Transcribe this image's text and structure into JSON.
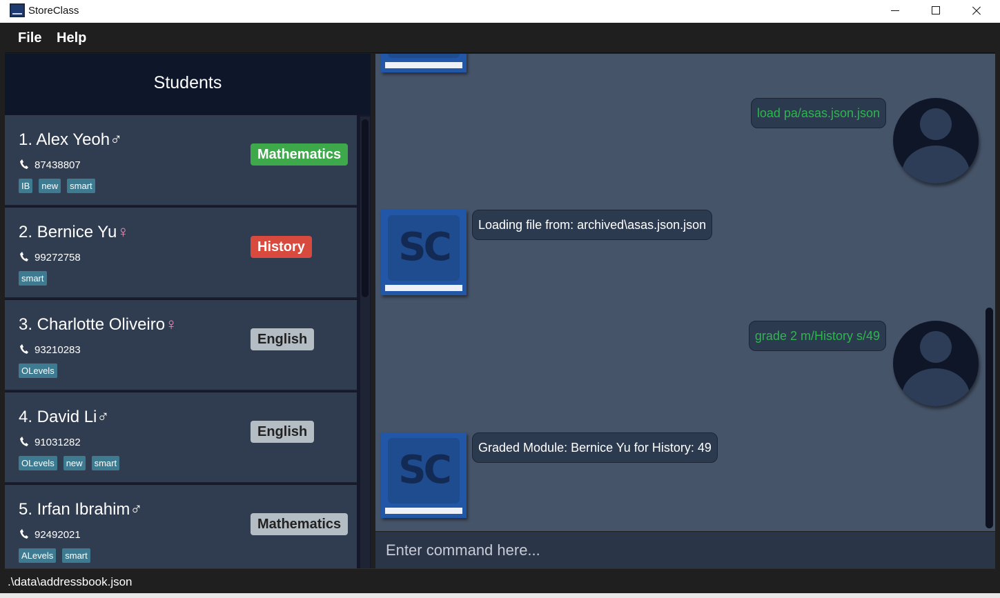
{
  "window": {
    "title": "StoreClass"
  },
  "menu": {
    "file": "File",
    "help": "Help"
  },
  "students_panel": {
    "title": "Students",
    "students": [
      {
        "name": "1. Alex Yeoh",
        "gender": "♂",
        "gender_color": "#ffffff",
        "phone": "87438807",
        "tags": [
          "IB",
          "new",
          "smart"
        ],
        "module": "Mathematics",
        "module_style": "mod-green"
      },
      {
        "name": "2. Bernice Yu",
        "gender": "♀",
        "gender_color": "#f08bb7",
        "phone": "99272758",
        "tags": [
          "smart"
        ],
        "module": "History",
        "module_style": "mod-red"
      },
      {
        "name": "3. Charlotte Oliveiro",
        "gender": "♀",
        "gender_color": "#f08bb7",
        "phone": "93210283",
        "tags": [
          "OLevels"
        ],
        "module": "English",
        "module_style": "mod-grey"
      },
      {
        "name": "4. David Li",
        "gender": "♂",
        "gender_color": "#ffffff",
        "phone": "91031282",
        "tags": [
          "OLevels",
          "new",
          "smart"
        ],
        "module": "English",
        "module_style": "mod-grey"
      },
      {
        "name": "5. Irfan Ibrahim",
        "gender": "♂",
        "gender_color": "#ffffff",
        "phone": "92492021",
        "tags": [
          "ALevels",
          "smart"
        ],
        "module": "Mathematics",
        "module_style": "mod-grey"
      }
    ]
  },
  "chat": {
    "avatar_logo_text": "SC",
    "messages": [
      {
        "role": "user",
        "text": "load pa/asas.json.json"
      },
      {
        "role": "bot",
        "text": "Loading file from: archived\\asas.json.json"
      },
      {
        "role": "user",
        "text": "grade 2 m/History s/49"
      },
      {
        "role": "bot",
        "text": "Graded Module: Bernice Yu for History: 49"
      }
    ]
  },
  "command": {
    "placeholder": "Enter command here..."
  },
  "status": {
    "path": ".\\data\\addressbook.json"
  },
  "colors": {
    "user_text": "#2fb54f",
    "module_green": "#3da94a",
    "module_red": "#d84a3d",
    "module_grey": "#b4bcc4"
  }
}
